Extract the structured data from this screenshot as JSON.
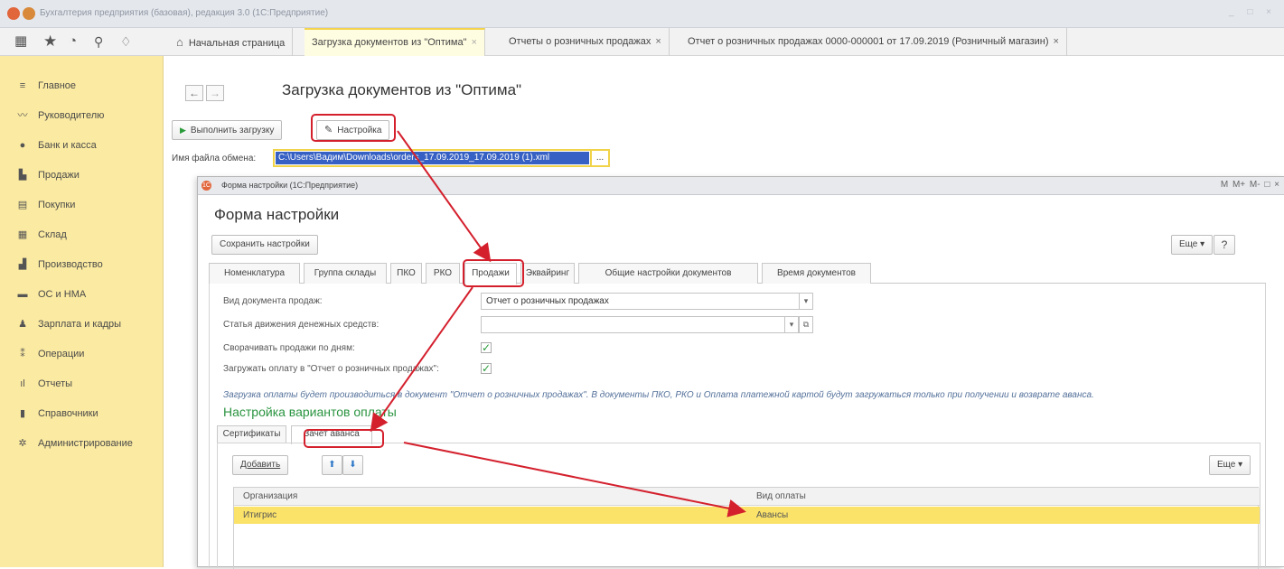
{
  "window": {
    "title": "Бухгалтерия предприятия (базовая), редакция 3.0 (1С:Предприятие)",
    "controls": "_ □ ×"
  },
  "toolbar": {
    "icons": [
      "apps-grid-icon",
      "star-icon",
      "history-icon",
      "search-icon",
      "bell-icon"
    ],
    "tabs": [
      {
        "label": "Начальная страница",
        "closable": false
      },
      {
        "label": "Загрузка документов из \"Оптима\"",
        "closable": true,
        "active": true
      },
      {
        "label": "Отчеты о розничных продажах",
        "closable": true
      },
      {
        "label": "Отчет о розничных продажах 0000-000001 от 17.09.2019 (Розничный магазин)",
        "closable": true
      }
    ],
    "close_glyph": "×",
    "home_glyph": "⌂"
  },
  "sidebar": {
    "items": [
      {
        "label": "Главное",
        "icon": "menu-icon"
      },
      {
        "label": "Руководителю",
        "icon": "chart-line-icon"
      },
      {
        "label": "Банк и касса",
        "icon": "bank-icon"
      },
      {
        "label": "Продажи",
        "icon": "sales-icon"
      },
      {
        "label": "Покупки",
        "icon": "cart-icon"
      },
      {
        "label": "Склад",
        "icon": "warehouse-icon"
      },
      {
        "label": "Производство",
        "icon": "factory-icon"
      },
      {
        "label": "ОС и НМА",
        "icon": "truck-icon"
      },
      {
        "label": "Зарплата и кадры",
        "icon": "person-icon"
      },
      {
        "label": "Операции",
        "icon": "operations-icon"
      },
      {
        "label": "Отчеты",
        "icon": "bar-chart-icon"
      },
      {
        "label": "Справочники",
        "icon": "book-icon"
      },
      {
        "label": "Администрирование",
        "icon": "gear-icon"
      }
    ]
  },
  "main": {
    "title": "Загрузка документов из \"Оптима\"",
    "back": "←",
    "forward": "→",
    "run_button": "Выполнить загрузку",
    "run_icon": "▶",
    "settings_button": "Настройка",
    "file_label": "Имя файла обмена:",
    "file_value": "C:\\Users\\Вадим\\Downloads\\orders_17.09.2019_17.09.2019 (1).xml",
    "file_more": "..."
  },
  "dialog": {
    "window_title": "Форма настройки  (1С:Предприятие)",
    "controls": "M M+ M- □ ×",
    "heading": "Форма настройки",
    "save_button": "Сохранить настройки",
    "more_button": "Еще ▾",
    "help_button": "?",
    "tabs": [
      "Номенклатура",
      "Группа склады",
      "ПКО",
      "РКО",
      "Продажи",
      "Эквайринг",
      "Общие настройки документов",
      "Время документов"
    ],
    "active_tab": "Продажи",
    "fields": {
      "doc_type_label": "Вид документа продаж:",
      "doc_type_value": "Отчет о розничных продажах",
      "cashflow_label": "Статья движения денежных средств:",
      "cashflow_value": "",
      "collapse_label": "Сворачивать продажи по дням:",
      "collapse_checked": true,
      "load_payment_label": "Загружать оплату в \"Отчет о розничных продажах\":",
      "load_payment_checked": true
    },
    "info_text": "Загрузка оплаты будет производиться в документ \"Отчет о розничных продажах\". В документы ПКО, РКО и Оплата платежной картой будут загружаться только при получении и возврате аванса.",
    "section_title": "Настройка вариантов оплаты",
    "subtabs": [
      "Сертификаты",
      "Зачет аванса"
    ],
    "active_subtab": "Зачет аванса",
    "add_button": "Добавить",
    "up_glyph": "⬆",
    "down_glyph": "⬇",
    "sub_more_button": "Еще ▾",
    "grid": {
      "columns": [
        "Организация",
        "Вид оплаты"
      ],
      "rows": [
        [
          "Итигрис",
          "Авансы"
        ]
      ]
    }
  },
  "colors": {
    "sidebar_bg": "#fbeaa1",
    "annotation_red": "#d4202d",
    "selected_row": "#fbe36a",
    "section_green": "#2a9440"
  }
}
